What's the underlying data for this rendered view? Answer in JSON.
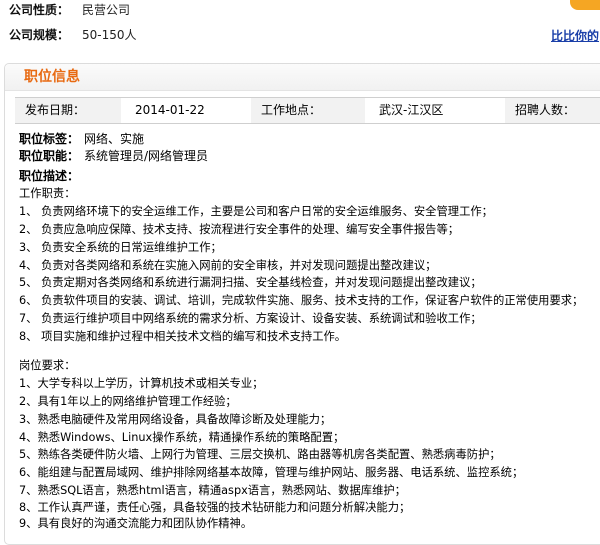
{
  "company": {
    "nature_label": "公司性质：",
    "nature_value": "民营公司",
    "scale_label": "公司规模：",
    "scale_value": "50-150人",
    "compare_link": "比比你的"
  },
  "section": {
    "title": "职位信息"
  },
  "info": {
    "post_date_label": "发布日期：",
    "post_date_value": "2014-01-22",
    "location_label": "工作地点：",
    "location_value": "武汉-江汉区",
    "recruit_label": "招聘人数："
  },
  "job": {
    "tag_label": "职位标签：",
    "tag_value": "网络、实施",
    "function_label": "职位职能：",
    "function_value": "系统管理员/网络管理员",
    "desc_label": "职位描述：",
    "duties_title": "工作职责：",
    "duties": [
      "1、 负责网络环境下的安全运维工作，主要是公司和客户日常的安全运维服务、安全管理工作；",
      "2、 负责应急响应保障、技术支持、按流程进行安全事件的处理、编写安全事件报告等；",
      "3、 负责安全系统的日常运维维护工作；",
      "4、 负责对各类网络和系统在实施入网前的安全审核，并对发现问题提出整改建议；",
      "5、 负责定期对各类网络和系统进行漏洞扫描、安全基线检查，并对发现问题提出整改建议；",
      "6、 负责软件项目的安装、调试、培训，完成软件实施、服务、技术支持的工作，保证客户软件的正常使用要求；",
      "7、 负责运行维护项目中网络系统的需求分析、方案设计、设备安装、系统调试和验收工作；",
      "8、 项目实施和维护过程中相关技术文档的编写和技术支持工作。"
    ],
    "req_title": "岗位要求：",
    "requirements": [
      "1、大学专科以上学历，计算机技术或相关专业；",
      "2、具有1年以上的网络维护管理工作经验；",
      "3、熟悉电脑硬件及常用网络设备，具备故障诊断及处理能力；",
      "4、熟悉Windows、Linux操作系统，精通操作系统的策略配置；",
      "5、熟练各类硬件防火墙、上网行为管理、三层交换机、路由器等机房各类配置、熟悉病毒防护；",
      "6、能组建与配置局域网、维护排除网络基本故障，管理与维护网站、服务器、电话系统、监控系统；",
      "7、熟悉SQL语言，熟悉html语言，精通aspx语言，熟悉网站、数据库维护；",
      "8、工作认真严谨，责任心强，具备较强的技术钻研能力和问题分析解决能力；",
      "9、具有良好的沟通交流能力和团队协作精神。"
    ]
  }
}
